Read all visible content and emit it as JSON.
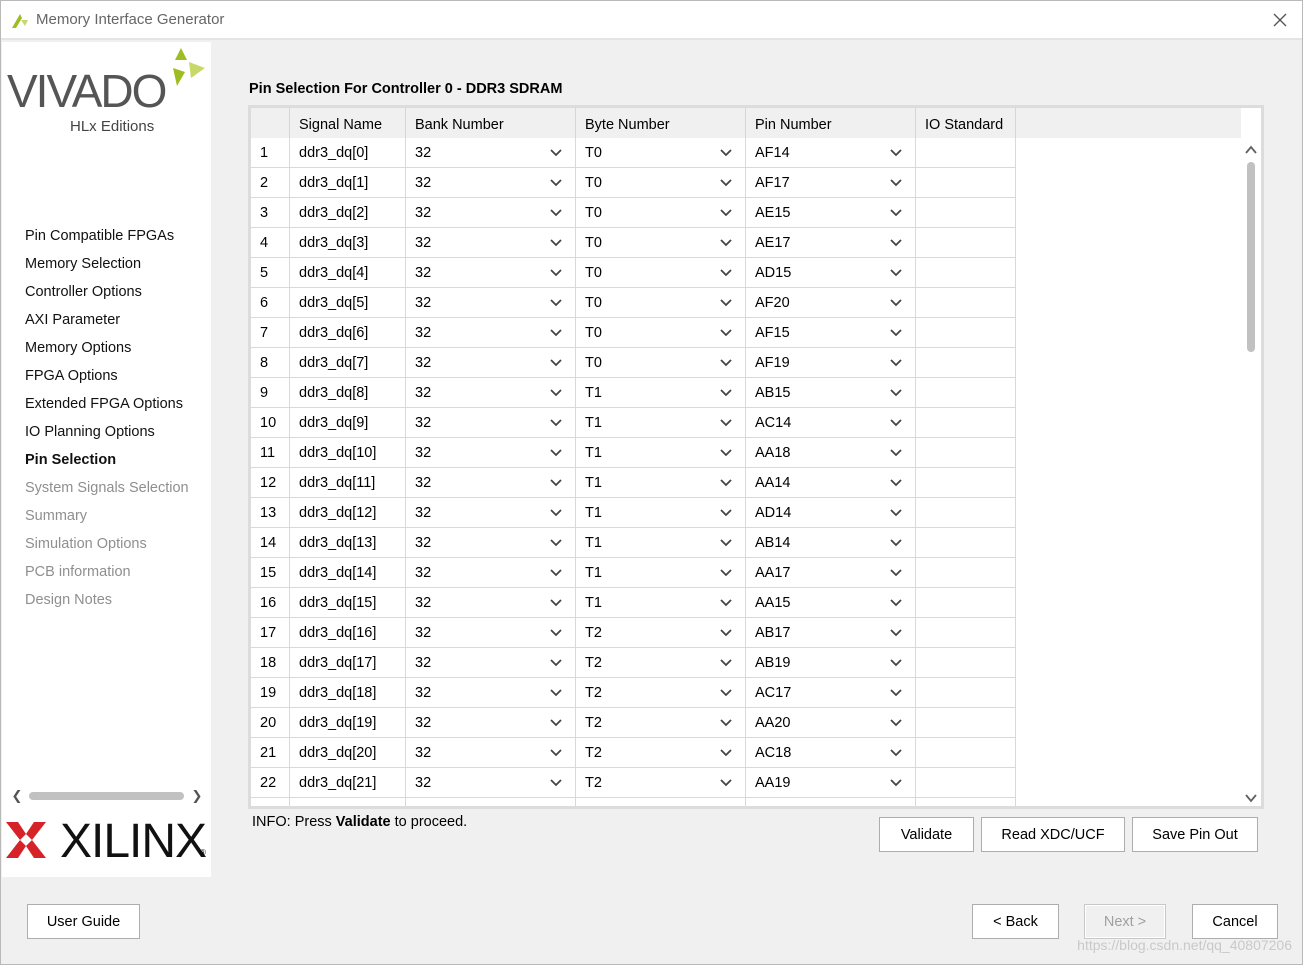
{
  "window": {
    "title": "Memory Interface Generator"
  },
  "sidebar": {
    "logo_text": "VIVADO",
    "logo_sub": "HLx Editions",
    "brand": "XILINX",
    "items": [
      {
        "label": "Pin Compatible FPGAs",
        "state": "normal"
      },
      {
        "label": "Memory Selection",
        "state": "normal"
      },
      {
        "label": "Controller Options",
        "state": "normal"
      },
      {
        "label": "AXI Parameter",
        "state": "normal"
      },
      {
        "label": "Memory Options",
        "state": "normal"
      },
      {
        "label": "FPGA Options",
        "state": "normal"
      },
      {
        "label": "Extended FPGA Options",
        "state": "normal"
      },
      {
        "label": "IO Planning Options",
        "state": "normal"
      },
      {
        "label": "Pin Selection",
        "state": "current"
      },
      {
        "label": "System Signals Selection",
        "state": "disabled"
      },
      {
        "label": "Summary",
        "state": "disabled"
      },
      {
        "label": "Simulation Options",
        "state": "disabled"
      },
      {
        "label": "PCB information",
        "state": "disabled"
      },
      {
        "label": "Design Notes",
        "state": "disabled"
      }
    ]
  },
  "main": {
    "title": "Pin Selection For Controller 0 - DDR3 SDRAM",
    "columns": [
      "",
      "Signal Name",
      "Bank Number",
      "Byte Number",
      "Pin Number",
      "IO Standard",
      ""
    ],
    "rows": [
      {
        "n": "1",
        "signal": "ddr3_dq[0]",
        "bank": "32",
        "byte": "T0",
        "pin": "AF14"
      },
      {
        "n": "2",
        "signal": "ddr3_dq[1]",
        "bank": "32",
        "byte": "T0",
        "pin": "AF17"
      },
      {
        "n": "3",
        "signal": "ddr3_dq[2]",
        "bank": "32",
        "byte": "T0",
        "pin": "AE15"
      },
      {
        "n": "4",
        "signal": "ddr3_dq[3]",
        "bank": "32",
        "byte": "T0",
        "pin": "AE17"
      },
      {
        "n": "5",
        "signal": "ddr3_dq[4]",
        "bank": "32",
        "byte": "T0",
        "pin": "AD15"
      },
      {
        "n": "6",
        "signal": "ddr3_dq[5]",
        "bank": "32",
        "byte": "T0",
        "pin": "AF20"
      },
      {
        "n": "7",
        "signal": "ddr3_dq[6]",
        "bank": "32",
        "byte": "T0",
        "pin": "AF15"
      },
      {
        "n": "8",
        "signal": "ddr3_dq[7]",
        "bank": "32",
        "byte": "T0",
        "pin": "AF19"
      },
      {
        "n": "9",
        "signal": "ddr3_dq[8]",
        "bank": "32",
        "byte": "T1",
        "pin": "AB15"
      },
      {
        "n": "10",
        "signal": "ddr3_dq[9]",
        "bank": "32",
        "byte": "T1",
        "pin": "AC14"
      },
      {
        "n": "11",
        "signal": "ddr3_dq[10]",
        "bank": "32",
        "byte": "T1",
        "pin": "AA18"
      },
      {
        "n": "12",
        "signal": "ddr3_dq[11]",
        "bank": "32",
        "byte": "T1",
        "pin": "AA14"
      },
      {
        "n": "13",
        "signal": "ddr3_dq[12]",
        "bank": "32",
        "byte": "T1",
        "pin": "AD14"
      },
      {
        "n": "14",
        "signal": "ddr3_dq[13]",
        "bank": "32",
        "byte": "T1",
        "pin": "AB14"
      },
      {
        "n": "15",
        "signal": "ddr3_dq[14]",
        "bank": "32",
        "byte": "T1",
        "pin": "AA17"
      },
      {
        "n": "16",
        "signal": "ddr3_dq[15]",
        "bank": "32",
        "byte": "T1",
        "pin": "AA15"
      },
      {
        "n": "17",
        "signal": "ddr3_dq[16]",
        "bank": "32",
        "byte": "T2",
        "pin": "AB17"
      },
      {
        "n": "18",
        "signal": "ddr3_dq[17]",
        "bank": "32",
        "byte": "T2",
        "pin": "AB19"
      },
      {
        "n": "19",
        "signal": "ddr3_dq[18]",
        "bank": "32",
        "byte": "T2",
        "pin": "AC17"
      },
      {
        "n": "20",
        "signal": "ddr3_dq[19]",
        "bank": "32",
        "byte": "T2",
        "pin": "AA20"
      },
      {
        "n": "21",
        "signal": "ddr3_dq[20]",
        "bank": "32",
        "byte": "T2",
        "pin": "AC18"
      },
      {
        "n": "22",
        "signal": "ddr3_dq[21]",
        "bank": "32",
        "byte": "T2",
        "pin": "AA19"
      },
      {
        "n": "",
        "signal": "",
        "bank": "",
        "byte": "",
        "pin": ""
      }
    ],
    "info_prefix": "INFO: Press ",
    "info_bold": "Validate",
    "info_suffix": " to proceed.",
    "buttons": {
      "validate": "Validate",
      "read_xdc": "Read XDC/UCF",
      "save_pin_out": "Save Pin Out"
    }
  },
  "footer": {
    "user_guide": "User Guide",
    "back": "< Back",
    "next": "Next >",
    "cancel": "Cancel"
  },
  "watermark": "https://blog.csdn.net/qq_40807206",
  "colors": {
    "vivado_green": "#9dbd22",
    "xilinx_red": "#d6232a"
  }
}
